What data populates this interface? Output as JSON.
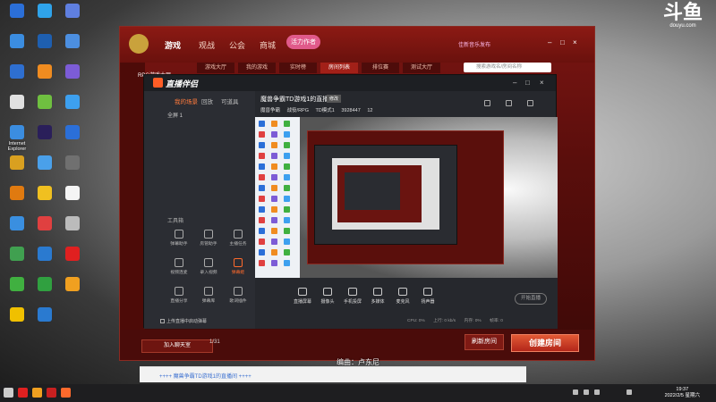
{
  "desktop": {
    "icons": [
      {
        "label": "",
        "color": "#2b6fd8"
      },
      {
        "label": "",
        "color": "#2fa3ea"
      },
      {
        "label": "",
        "color": "#5f7fe0"
      },
      {
        "label": "",
        "color": "#3b8de0"
      },
      {
        "label": "",
        "color": "#1e5fb0"
      },
      {
        "label": "",
        "color": "#4c8fe0"
      },
      {
        "label": "",
        "color": "#2e6fd0"
      },
      {
        "label": "",
        "color": "#f08c20"
      },
      {
        "label": "",
        "color": "#7c5cd6"
      },
      {
        "label": "",
        "color": "#e0e0e0"
      },
      {
        "label": "",
        "color": "#6fc040"
      },
      {
        "label": "",
        "color": "#3da0ef"
      },
      {
        "label": "Internet Explorer",
        "color": "#3b8de0"
      },
      {
        "label": "",
        "color": "#2a1f5a"
      },
      {
        "label": "",
        "color": "#2b6fd8"
      },
      {
        "label": "",
        "color": "#d9a020"
      },
      {
        "label": "",
        "color": "#4aa0ea"
      },
      {
        "label": "",
        "color": "#707070"
      },
      {
        "label": "",
        "color": "#e07a10"
      },
      {
        "label": "",
        "color": "#f0c020"
      },
      {
        "label": "",
        "color": "#f5f5f5"
      },
      {
        "label": "",
        "color": "#3a8fe0"
      },
      {
        "label": "",
        "color": "#e04040"
      },
      {
        "label": "",
        "color": "#bbbbbb"
      },
      {
        "label": "",
        "color": "#40a050"
      },
      {
        "label": "",
        "color": "#2a7ad0"
      },
      {
        "label": "",
        "color": "#e02020"
      },
      {
        "label": "",
        "color": "#40b040"
      },
      {
        "label": "",
        "color": "#30a040"
      },
      {
        "label": "",
        "color": "#f0a020"
      },
      {
        "label": "",
        "color": "#f0c000"
      },
      {
        "label": "",
        "color": "#2a7ad0"
      }
    ]
  },
  "watermark": {
    "logo": "斗鱼",
    "sub": "douyu.com"
  },
  "game": {
    "tabs": [
      "游戏",
      "观战",
      "公会",
      "商城"
    ],
    "badge": "活力作者",
    "subtabs": [
      "游戏大厅",
      "我的游戏",
      "实时榜",
      "房间列表",
      "排位赛",
      "测试大厅"
    ],
    "search_placeholder": "搜索游戏名/房间名称",
    "user": "佳新音乐发布",
    "side_label": "RPG游戏大厅",
    "join_label": "加入聊天室",
    "pager": "1/31",
    "refresh_label": "刷新房间",
    "create_label": "创建房间"
  },
  "live": {
    "app_name": "直播伴侣",
    "left_tabs": [
      "我的场景",
      "回放",
      "可道具"
    ],
    "scene": "全屏 1",
    "tools_label": "工具箱",
    "tools": [
      {
        "label": "弹幕助手",
        "active": false
      },
      {
        "label": "房管助手",
        "active": false
      },
      {
        "label": "主播任务",
        "active": false
      },
      {
        "label": "视频连麦",
        "active": false
      },
      {
        "label": "录入视频",
        "active": false
      },
      {
        "label": "弹幕姬",
        "active": true
      },
      {
        "label": "直播分享",
        "active": false
      },
      {
        "label": "弹幕库",
        "active": false
      },
      {
        "label": "歌词插件",
        "active": false
      }
    ],
    "notice": "上传直播中启动弹幕",
    "room_title": "魔兽争霸TD游戏1的直播间",
    "room_tag": "修改",
    "meta": [
      "魔兽争霸",
      "战役/RPG",
      "TD模式1",
      "3928447",
      "12"
    ],
    "bottom_buttons": [
      "直播屏幕",
      "摄像头",
      "手机投屏",
      "多媒体",
      "麦克风",
      "扬声器"
    ],
    "live_btn": "开始直播",
    "stats": [
      "CPU: 0%",
      "上行: 0 kb/s",
      "内存: 0%",
      "帧率: 0"
    ]
  },
  "overlay": {
    "streamer": "编曲：卢东尼",
    "bottom_link": "++++ 魔兽争霸TD游戏1的直播间 ++++"
  },
  "taskbar": {
    "icons": [
      {
        "name": "start-icon",
        "color": "#cccccc"
      },
      {
        "name": "netease-icon",
        "color": "#e02020"
      },
      {
        "name": "app-icon",
        "color": "#f0a020"
      },
      {
        "name": "war3-icon",
        "color": "#c82020"
      },
      {
        "name": "douyu-icon",
        "color": "#ff6a2c"
      }
    ],
    "time": "19:37",
    "date": "2022/2/5 星期六"
  }
}
